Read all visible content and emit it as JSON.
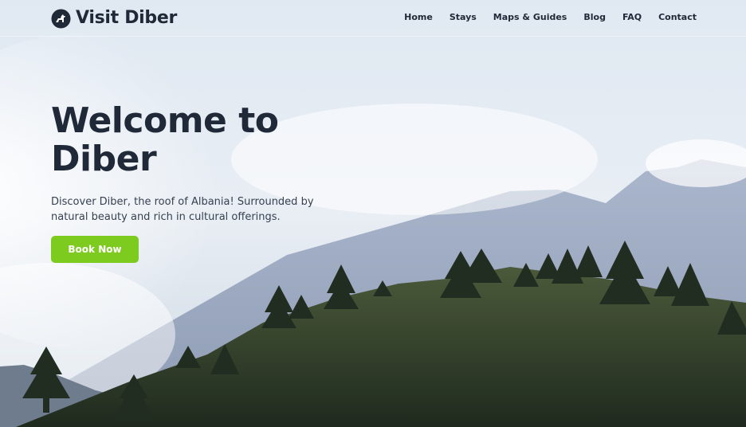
{
  "brand": {
    "name": "Visit Diber",
    "logo_icon": "mountain-goat-icon"
  },
  "nav": {
    "items": [
      {
        "label": "Home"
      },
      {
        "label": "Stays"
      },
      {
        "label": "Maps & Guides"
      },
      {
        "label": "Blog"
      },
      {
        "label": "FAQ"
      },
      {
        "label": "Contact"
      }
    ]
  },
  "hero": {
    "title_line1": "Welcome to",
    "title_line2": "Diber",
    "subtitle": "Discover Diber, the roof of Albania! Surrounded by natural beauty and rich in cultural offerings.",
    "cta_label": "Book Now",
    "background": "mountain-landscape-photo"
  },
  "colors": {
    "accent": "#7ecb20",
    "text_dark": "#1f2937",
    "text_body": "#374151"
  }
}
